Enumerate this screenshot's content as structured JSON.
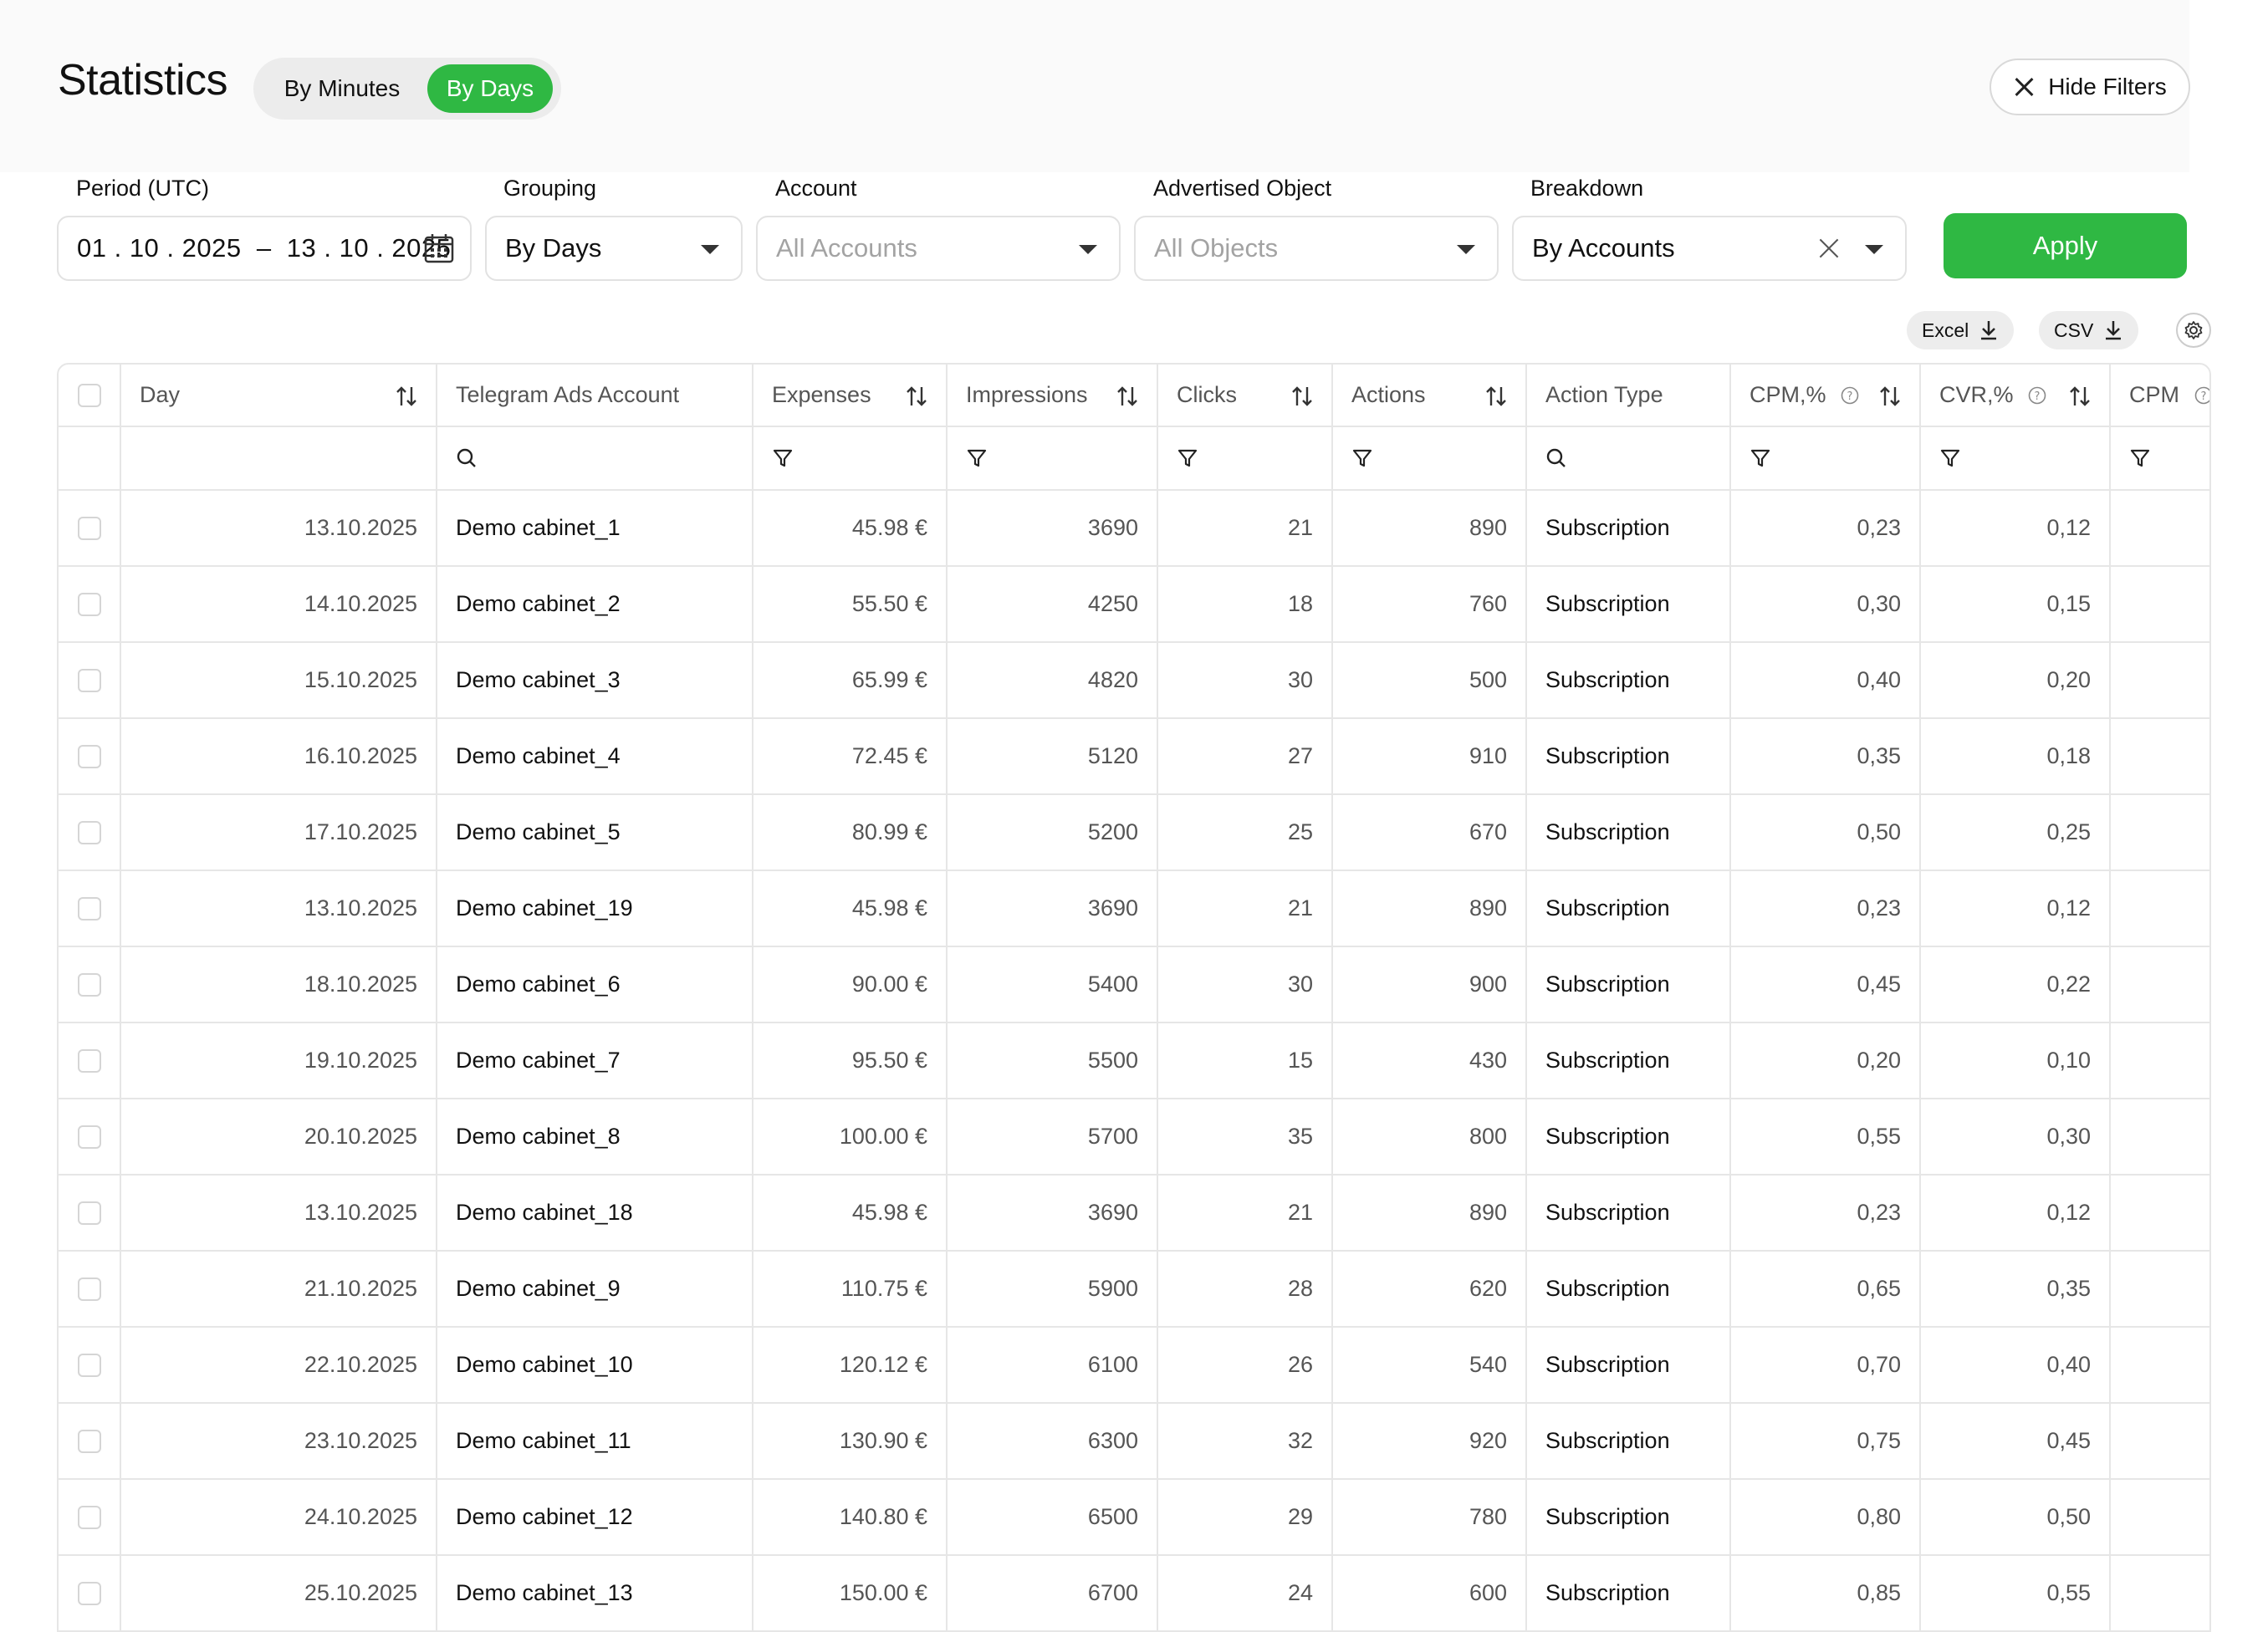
{
  "header": {
    "title": "Statistics",
    "toggle": {
      "by_minutes": "By Minutes",
      "by_days": "By Days"
    },
    "hide_filters": "Hide Filters"
  },
  "filters": {
    "period": {
      "label": "Period (UTC)",
      "value": "01 . 10 . 2025  –  13 . 10 . 2025"
    },
    "grouping": {
      "label": "Grouping",
      "value": "By Days"
    },
    "account": {
      "label": "Account",
      "placeholder": "All Accounts"
    },
    "advertised": {
      "label": "Advertised Object",
      "placeholder": "All Objects"
    },
    "breakdown": {
      "label": "Breakdown",
      "value": "By Accounts"
    },
    "apply": "Apply"
  },
  "export": {
    "excel": "Excel",
    "csv": "CSV"
  },
  "table": {
    "columns": [
      "Day",
      "Telegram Ads Account",
      "Expenses",
      "Impressions",
      "Clicks",
      "Actions",
      "Action Type",
      "CPM,%",
      "CVR,%",
      "CPM"
    ],
    "rows": [
      [
        "13.10.2025",
        "Demo cabinet_1",
        "45.98 €",
        "3690",
        "21",
        "890",
        "Subscription",
        "0,23",
        "0,12"
      ],
      [
        "14.10.2025",
        "Demo cabinet_2",
        "55.50 €",
        "4250",
        "18",
        "760",
        "Subscription",
        "0,30",
        "0,15"
      ],
      [
        "15.10.2025",
        "Demo cabinet_3",
        "65.99 €",
        "4820",
        "30",
        "500",
        "Subscription",
        "0,40",
        "0,20"
      ],
      [
        "16.10.2025",
        "Demo cabinet_4",
        "72.45 €",
        "5120",
        "27",
        "910",
        "Subscription",
        "0,35",
        "0,18"
      ],
      [
        "17.10.2025",
        "Demo cabinet_5",
        "80.99 €",
        "5200",
        "25",
        "670",
        "Subscription",
        "0,50",
        "0,25"
      ],
      [
        "13.10.2025",
        "Demo cabinet_19",
        "45.98 €",
        "3690",
        "21",
        "890",
        "Subscription",
        "0,23",
        "0,12"
      ],
      [
        "18.10.2025",
        "Demo cabinet_6",
        "90.00 €",
        "5400",
        "30",
        "900",
        "Subscription",
        "0,45",
        "0,22"
      ],
      [
        "19.10.2025",
        "Demo cabinet_7",
        "95.50 €",
        "5500",
        "15",
        "430",
        "Subscription",
        "0,20",
        "0,10"
      ],
      [
        "20.10.2025",
        "Demo cabinet_8",
        "100.00 €",
        "5700",
        "35",
        "800",
        "Subscription",
        "0,55",
        "0,30"
      ],
      [
        "13.10.2025",
        "Demo cabinet_18",
        "45.98 €",
        "3690",
        "21",
        "890",
        "Subscription",
        "0,23",
        "0,12"
      ],
      [
        "21.10.2025",
        "Demo cabinet_9",
        "110.75 €",
        "5900",
        "28",
        "620",
        "Subscription",
        "0,65",
        "0,35"
      ],
      [
        "22.10.2025",
        "Demo cabinet_10",
        "120.12 €",
        "6100",
        "26",
        "540",
        "Subscription",
        "0,70",
        "0,40"
      ],
      [
        "23.10.2025",
        "Demo cabinet_11",
        "130.90 €",
        "6300",
        "32",
        "920",
        "Subscription",
        "0,75",
        "0,45"
      ],
      [
        "24.10.2025",
        "Demo cabinet_12",
        "140.80 €",
        "6500",
        "29",
        "780",
        "Subscription",
        "0,80",
        "0,50"
      ],
      [
        "25.10.2025",
        "Demo cabinet_13",
        "150.00 €",
        "6700",
        "24",
        "600",
        "Subscription",
        "0,85",
        "0,55"
      ]
    ]
  },
  "colors": {
    "accent": "#2fb843",
    "border": "#e6e6e6",
    "muted": "#555555"
  }
}
